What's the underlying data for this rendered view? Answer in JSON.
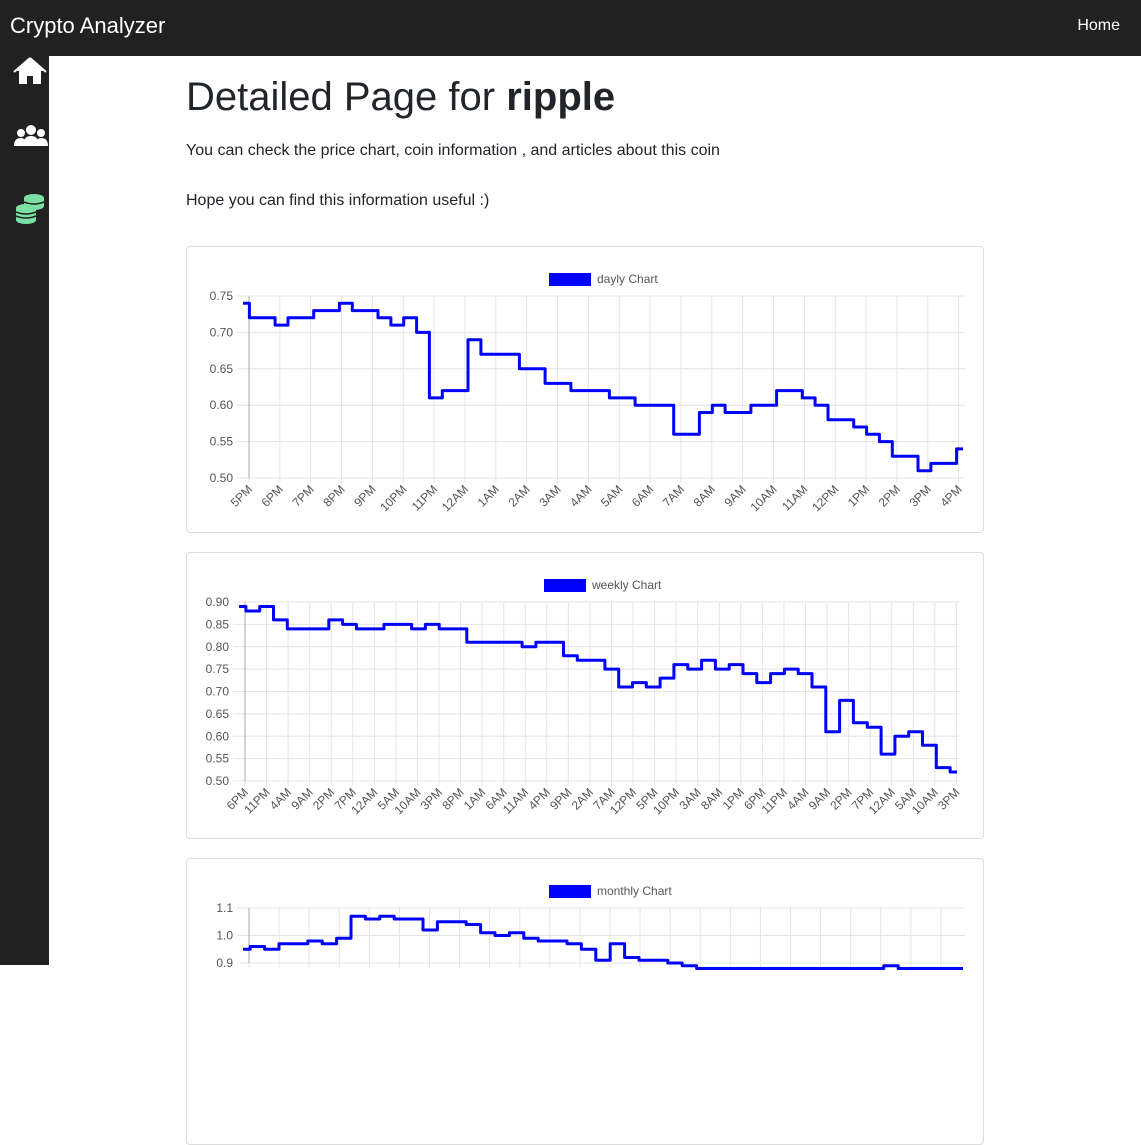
{
  "header": {
    "brand": "Crypto Analyzer",
    "home_link": "Home"
  },
  "sidebar": {
    "items": [
      {
        "icon": "home-icon"
      },
      {
        "icon": "users-icon"
      },
      {
        "icon": "coins-icon",
        "color": "#7be0a4"
      }
    ]
  },
  "page": {
    "title_prefix": "Detailed Page for",
    "title_coin": "ripple",
    "intro": "You can check the price chart, coin information , and articles about this coin",
    "note": "Hope you can find this information useful :)"
  },
  "chart_data": [
    {
      "type": "line",
      "legend": "dayly  Chart",
      "color": "#0000ff",
      "ylim": [
        0.5,
        0.75
      ],
      "yticks": [
        "0.75",
        "0.70",
        "0.65",
        "0.60",
        "0.55",
        "0.50"
      ],
      "categories": [
        "5PM",
        "6PM",
        "7PM",
        "8PM",
        "9PM",
        "10PM",
        "11PM",
        "12AM",
        "1AM",
        "2AM",
        "3AM",
        "4AM",
        "5AM",
        "6AM",
        "7AM",
        "8AM",
        "9AM",
        "10AM",
        "11AM",
        "12PM",
        "1PM",
        "2PM",
        "3PM",
        "4PM"
      ],
      "x": [
        0,
        0.5,
        1,
        1.5,
        2,
        2.5,
        3,
        3.5,
        4,
        4.5,
        5,
        5.5,
        6,
        6.5,
        7,
        7.5,
        8,
        8.5,
        9,
        9.5,
        10,
        10.5,
        11,
        11.5,
        12,
        12.5,
        13,
        13.5,
        14,
        14.5,
        15,
        15.5,
        16,
        16.5,
        17,
        17.5,
        18,
        18.5,
        19,
        19.5,
        20,
        20.5,
        21,
        21.5,
        22,
        22.5,
        23,
        23.5,
        23.8
      ],
      "values": [
        0.74,
        0.72,
        0.72,
        0.71,
        0.72,
        0.72,
        0.73,
        0.73,
        0.74,
        0.73,
        0.73,
        0.72,
        0.71,
        0.72,
        0.7,
        0.61,
        0.62,
        0.62,
        0.69,
        0.67,
        0.67,
        0.67,
        0.65,
        0.65,
        0.63,
        0.63,
        0.62,
        0.62,
        0.62,
        0.61,
        0.61,
        0.6,
        0.6,
        0.6,
        0.56,
        0.56,
        0.59,
        0.6,
        0.59,
        0.59,
        0.6,
        0.6,
        0.62,
        0.62,
        0.61,
        0.6,
        0.58,
        0.58,
        0.57,
        0.56,
        0.55,
        0.53,
        0.53,
        0.51,
        0.52,
        0.52,
        0.54
      ]
    },
    {
      "type": "line",
      "legend": "weekly  Chart",
      "color": "#0000ff",
      "ylim": [
        0.5,
        0.9
      ],
      "yticks": [
        "0.90",
        "0.85",
        "0.80",
        "0.75",
        "0.70",
        "0.65",
        "0.60",
        "0.55",
        "0.50"
      ],
      "categories": [
        "6PM",
        "11PM",
        "4AM",
        "9AM",
        "2PM",
        "7PM",
        "12AM",
        "5AM",
        "10AM",
        "3PM",
        "8PM",
        "1AM",
        "6AM",
        "11AM",
        "4PM",
        "9PM",
        "2AM",
        "7AM",
        "12PM",
        "5PM",
        "10PM",
        "3AM",
        "8AM",
        "1PM",
        "6PM",
        "11PM",
        "4AM",
        "9AM",
        "2PM",
        "7PM",
        "12AM",
        "5AM",
        "10AM",
        "3PM"
      ],
      "x": [
        0,
        0.5,
        1,
        1.5,
        2,
        2.5,
        3,
        3.5,
        4,
        4.5,
        5,
        6,
        7,
        8,
        9,
        10,
        11,
        12,
        13,
        14,
        15,
        16,
        17,
        18,
        19,
        20,
        20.5,
        21,
        21.5,
        22,
        22.5,
        23,
        23.5,
        24,
        24.5,
        25,
        25.5,
        26,
        26.5,
        27,
        27.5,
        28,
        28.5,
        29,
        29.5,
        30,
        30.5,
        31,
        31.5,
        32,
        32.5,
        33,
        33.3
      ],
      "values": [
        0.89,
        0.88,
        0.89,
        0.86,
        0.84,
        0.84,
        0.84,
        0.86,
        0.85,
        0.84,
        0.84,
        0.85,
        0.85,
        0.84,
        0.85,
        0.84,
        0.84,
        0.81,
        0.81,
        0.81,
        0.81,
        0.8,
        0.81,
        0.81,
        0.78,
        0.77,
        0.77,
        0.75,
        0.71,
        0.72,
        0.71,
        0.73,
        0.76,
        0.75,
        0.77,
        0.75,
        0.76,
        0.74,
        0.72,
        0.74,
        0.75,
        0.74,
        0.71,
        0.61,
        0.68,
        0.63,
        0.62,
        0.56,
        0.6,
        0.61,
        0.58,
        0.53,
        0.52
      ]
    },
    {
      "type": "line",
      "legend": "monthly  Chart",
      "color": "#0000ff",
      "ylim": [
        0.9,
        1.1
      ],
      "yticks": [
        "1.1",
        "1.0",
        "0.9"
      ],
      "x": [
        0,
        1,
        2,
        3,
        4,
        5,
        6,
        7,
        8,
        9,
        10,
        11,
        12,
        13,
        14,
        15,
        16,
        17,
        18,
        19,
        20,
        21,
        22,
        23,
        24,
        25,
        26,
        27,
        28,
        29,
        30,
        31,
        32,
        33,
        34,
        35,
        36,
        37,
        38,
        39,
        40,
        41,
        42,
        43,
        44,
        45,
        46,
        47,
        48,
        49,
        50
      ],
      "values": [
        0.95,
        0.96,
        0.95,
        0.97,
        0.97,
        0.98,
        0.97,
        0.99,
        1.07,
        1.06,
        1.07,
        1.06,
        1.06,
        1.02,
        1.05,
        1.05,
        1.04,
        1.01,
        1.0,
        1.01,
        0.99,
        0.98,
        0.98,
        0.97,
        0.95,
        0.91,
        0.97,
        0.92,
        0.91,
        0.91,
        0.9,
        0.89,
        0.88,
        0.88,
        0.88,
        0.88,
        0.88,
        0.88,
        0.88,
        0.88,
        0.88,
        0.88,
        0.88,
        0.88,
        0.88,
        0.89,
        0.88,
        0.88,
        0.88,
        0.88,
        0.88
      ]
    }
  ]
}
